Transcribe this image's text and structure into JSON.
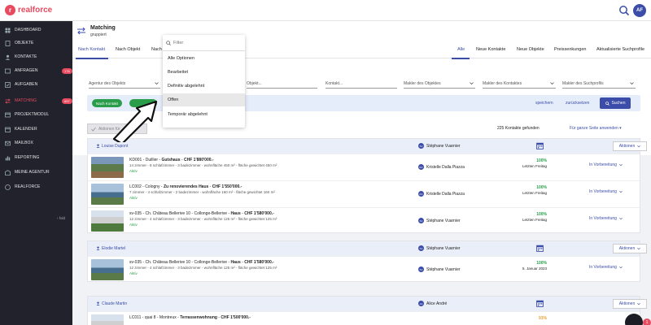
{
  "brand": {
    "name": "realforce",
    "logo_letter": "r",
    "accent": "#e84a5f",
    "primary": "#3b4da8"
  },
  "user": {
    "initials": "AF"
  },
  "sidebar": {
    "items": [
      {
        "label": "DASHBOARD",
        "icon": "dashboard-icon"
      },
      {
        "label": "OBJEKTE",
        "icon": "building-icon"
      },
      {
        "label": "KONTAKTE",
        "icon": "contact-icon"
      },
      {
        "label": "ANFRAGEN",
        "icon": "inbox-icon",
        "badge": "176"
      },
      {
        "label": "AUFGABEN",
        "icon": "checkbox-icon"
      },
      {
        "label": "MATCHING",
        "icon": "matching-icon",
        "badge": "697",
        "active": true
      },
      {
        "label": "PROJEKTMODUL",
        "icon": "project-icon"
      },
      {
        "label": "KALENDER",
        "icon": "calendar-icon"
      },
      {
        "label": "MAILBOX",
        "icon": "mail-icon"
      },
      {
        "label": "REPORTING",
        "icon": "chart-icon"
      },
      {
        "label": "MEINE AGENTUR",
        "icon": "agency-icon"
      },
      {
        "label": "REALFORCE",
        "icon": "realforce-icon"
      }
    ],
    "collapse_label": "‹ fold"
  },
  "header": {
    "title": "Matching",
    "subtitle": "gruppiert"
  },
  "tabs_left": [
    "Nach Kontakt",
    "Nach Objekt",
    "Nach"
  ],
  "tabs_right": [
    "Alle",
    "Neue Kontakte",
    "Neue Objekte",
    "Preissenkungen",
    "Aktualisierte Suchprofile"
  ],
  "filters": {
    "agent_object": "Agentur des Objekts",
    "object": "Objekt...",
    "contact": "Kontakt...",
    "broker_object": "Makler des Objektes",
    "broker_contact": "Makler des Kontaktes",
    "broker_profile": "Makler des Suchprofils"
  },
  "chips": {
    "by_contact": "Nach Kontakt",
    "second": ""
  },
  "chipbar_actions": {
    "save": "speichern",
    "reset": "zurücksetzen",
    "search": "Suchen"
  },
  "action_button": "Aktionen für",
  "results": {
    "count": "225 Kontakte gefunden",
    "apply_all": "Für ganze Seite anwenden"
  },
  "dropdown": {
    "placeholder": "Filter",
    "options": [
      "Alle Optionen",
      "Bearbeitet",
      "Definitiv abgelehnt",
      "Offen",
      "Temporär abgelehnt"
    ],
    "highlighted": 3
  },
  "groups": [
    {
      "contact": "Louise Dupont",
      "agent_initials": "SV",
      "agent": "Stéphane Vuarnier",
      "actions_label": "Aktionen",
      "properties": [
        {
          "code": "KD001",
          "place": "Duillier",
          "title": "Gutshaus",
          "price": "CHF 1'880'000.-",
          "details": "14 zimmer - 8 schlafzimmer - 3 badezimmer - wohnfläche 450 m² - fläche gewichtet 450 m²",
          "status": "Aktiv",
          "agent_initials": "KD",
          "agent": "Kristelle Dalla Piazza",
          "match": "100%",
          "date": "Letzten Freitag",
          "stage": "In Vorbereitung"
        },
        {
          "code": "LC002",
          "place": "Cologny",
          "title": "Zu renovierendes Haus",
          "price": "CHF 1'550'000.-",
          "details": "7 zimmer - 4 schlafzimmer - 2 badezimmer - wohnfläche 160 m² - fläche gewichtet 160 m²",
          "status": "Aktiv",
          "agent_initials": "KD",
          "agent": "Kristelle Dalla Piazza",
          "match": "100%",
          "date": "Letzten Freitag",
          "stage": "In Vorbereitung"
        },
        {
          "code": "sv-035",
          "place": "Ch. Château Bellerive 10 - Collonge-Bellerive",
          "title": "Haus",
          "price": "CHF 1'580'000.-",
          "details": "12 zimmer - 4 schlafzimmer - 3 badezimmer - wohnfläche 125 m² - fläche gewichtet 125 m²",
          "status": "Aktiv",
          "agent_initials": "SV",
          "agent": "Stéphane Vuarnier",
          "match": "100%",
          "date": "Letzten Freitag",
          "stage": "In Vorbereitung"
        }
      ]
    },
    {
      "contact": "Elodie Martel",
      "agent_initials": "SV",
      "agent": "Stéphane Vuarnier",
      "actions_label": "Aktionen",
      "properties": [
        {
          "code": "sv-035",
          "place": "Ch. Château Bellerive 10 - Collonge-Bellerive",
          "title": "Haus",
          "price": "CHF 1'580'000.-",
          "details": "12 zimmer - 4 schlafzimmer - 3 badezimmer - wohnfläche 125 m² - fläche gewichtet 125 m²",
          "status": "Aktiv",
          "agent_initials": "SV",
          "agent": "Stéphane Vuarnier",
          "match": "100%",
          "date": "5. Januar 2023",
          "stage": "In Vorbereitung"
        }
      ]
    },
    {
      "contact": "Claude Martin",
      "agent_initials": "AA",
      "agent": "Alice André",
      "actions_label": "Aktionen",
      "properties": [
        {
          "code": "LC011",
          "place": "quai 8 - Montreux",
          "title": "Terrassenwohnung",
          "price": "CHF 1'500'000.-",
          "details": "",
          "status": "",
          "agent_initials": "",
          "agent": "",
          "match": "93%",
          "date": "",
          "stage": ""
        }
      ]
    }
  ],
  "help_badge": "1"
}
